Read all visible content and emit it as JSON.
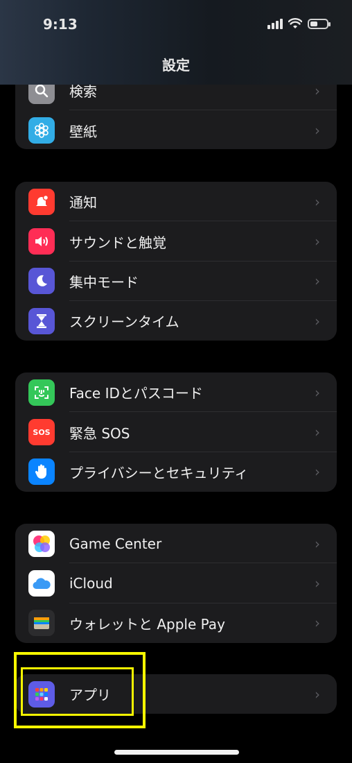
{
  "status_bar": {
    "time": "9:13"
  },
  "nav": {
    "title": "設定"
  },
  "groups": [
    {
      "items": [
        {
          "label": "検索",
          "icon": "search-icon",
          "color": "#8e8e93"
        },
        {
          "label": "壁紙",
          "icon": "wallpaper-icon",
          "color": "#32ade6"
        }
      ]
    },
    {
      "items": [
        {
          "label": "通知",
          "icon": "notifications-icon",
          "color": "#ff3b30"
        },
        {
          "label": "サウンドと触覚",
          "icon": "sound-icon",
          "color": "#ff2d55"
        },
        {
          "label": "集中モード",
          "icon": "moon-icon",
          "color": "#5856d6"
        },
        {
          "label": "スクリーンタイム",
          "icon": "hourglass-icon",
          "color": "#5856d6"
        }
      ]
    },
    {
      "items": [
        {
          "label": "Face IDとパスコード",
          "icon": "face-id-icon",
          "color": "#34c759"
        },
        {
          "label": "緊急 SOS",
          "icon": "sos-icon",
          "color": "#ff3b30"
        },
        {
          "label": "プライバシーとセキュリティ",
          "icon": "hand-icon",
          "color": "#0a84ff"
        }
      ]
    },
    {
      "items": [
        {
          "label": "Game Center",
          "icon": "game-center-icon",
          "color": "#ffffff"
        },
        {
          "label": "iCloud",
          "icon": "icloud-icon",
          "color": "#ffffff"
        },
        {
          "label": "ウォレットと Apple Pay",
          "icon": "wallet-icon",
          "color": "#2c2c2e"
        }
      ]
    },
    {
      "items": [
        {
          "label": "アプリ",
          "icon": "apps-grid-icon",
          "color": "#5e5ce6"
        }
      ]
    }
  ],
  "chevron": "›",
  "highlight_color": "#f8f800"
}
